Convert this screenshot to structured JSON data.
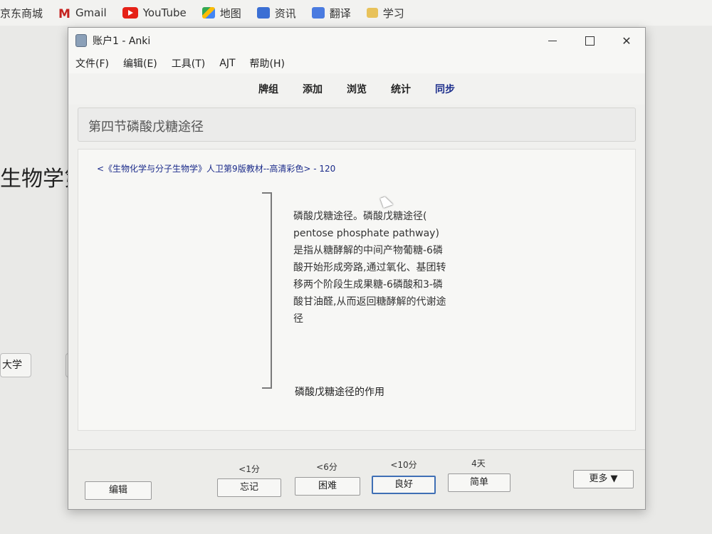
{
  "bookmarks": [
    {
      "label": "京东商城",
      "icon": "jd-icon"
    },
    {
      "label": "Gmail",
      "icon": "gmail-icon"
    },
    {
      "label": "YouTube",
      "icon": "youtube-icon"
    },
    {
      "label": "地图",
      "icon": "map-icon"
    },
    {
      "label": "资讯",
      "icon": "news-icon"
    },
    {
      "label": "翻译",
      "icon": "translate-icon"
    },
    {
      "label": "学习",
      "icon": "folder-icon"
    }
  ],
  "background": {
    "heading": "生物学第",
    "chip": "大学"
  },
  "window": {
    "title": "账户1 - Anki",
    "minimize": "—",
    "close": "✕"
  },
  "menu": [
    "文件(F)",
    "编辑(E)",
    "工具(T)",
    "AJT",
    "帮助(H)"
  ],
  "toolbar": [
    "牌组",
    "添加",
    "浏览",
    "统计",
    "同步"
  ],
  "deck_header": "第四节磷酸戊糖途径",
  "card": {
    "source": "<《生物化学与分子生物学》人卫第9版教材--高清彩色> - 120",
    "text": "磷酸戊糖途径。磷酸戊糖途径( pentose phosphate pathway)是指从糖酵解的中间产物葡糖-6磷酸开始形成旁路,通过氧化、基团转移两个阶段生成果糖-6磷酸和3-磷酸甘油醛,从而返回糖酵解的代谢途径",
    "subtitle": "磷酸戊糖途径的作用"
  },
  "bottom": {
    "edit": "编辑",
    "more": "更多 ▼",
    "answers": [
      {
        "interval": "<1分",
        "label": "忘记"
      },
      {
        "interval": "<6分",
        "label": "困难"
      },
      {
        "interval": "<10分",
        "label": "良好"
      },
      {
        "interval": "4天",
        "label": "简单"
      }
    ]
  },
  "colors": {
    "sync_link": "#1c2e8c",
    "source_text": "#1b2b8a",
    "default_button_border": "#3f6fb5"
  }
}
